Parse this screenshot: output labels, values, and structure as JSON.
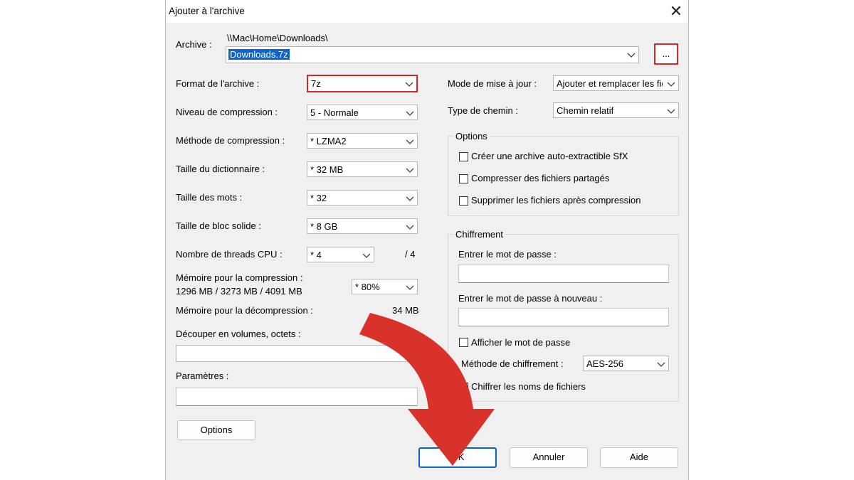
{
  "window": {
    "title": "Ajouter à l'archive",
    "close": "✕"
  },
  "archive": {
    "label": "Archive :",
    "path": "\\\\Mac\\Home\\Downloads\\",
    "filename": "Downloads.7z",
    "browse": "..."
  },
  "left": {
    "format": {
      "label": "Format de l'archive :",
      "value": "7z"
    },
    "level": {
      "label": "Niveau de compression :",
      "value": "5 - Normale"
    },
    "method": {
      "label": "Méthode de compression :",
      "value": "* LZMA2"
    },
    "dict": {
      "label": "Taille du dictionnaire :",
      "value": "* 32 MB"
    },
    "word": {
      "label": "Taille des mots :",
      "value": "* 32"
    },
    "solid": {
      "label": "Taille de bloc solide :",
      "value": "* 8 GB"
    },
    "threads": {
      "label": "Nombre de threads CPU :",
      "value": "* 4",
      "total": "/ 4"
    },
    "memcomp": {
      "label": "Mémoire pour la compression :",
      "detail": "1296 MB / 3273 MB / 4091 MB",
      "value": "* 80%"
    },
    "memdecomp": {
      "label": "Mémoire pour la décompression :",
      "value": "34 MB"
    },
    "split": {
      "label": "Découper en volumes, octets :",
      "value": ""
    },
    "params": {
      "label": "Paramètres :",
      "value": ""
    },
    "options_button": "Options"
  },
  "right": {
    "update": {
      "label": "Mode de mise à jour :",
      "value": "Ajouter et remplacer les fichiers"
    },
    "pathtype": {
      "label": "Type de chemin :",
      "value": "Chemin relatif"
    },
    "options": {
      "title": "Options",
      "items": [
        {
          "label": "Créer une archive auto-extractible SfX",
          "checked": false
        },
        {
          "label": "Compresser des fichiers partagés",
          "checked": false
        },
        {
          "label": "Supprimer les fichiers après compression",
          "checked": false
        }
      ]
    },
    "encryption": {
      "title": "Chiffrement",
      "pw_label": "Entrer le mot de passe :",
      "pw2_label": "Entrer le mot de passe à nouveau :",
      "show_pw": "Afficher le mot de passe",
      "method_label": "Méthode de chiffrement :",
      "method_value": "AES-256",
      "encrypt_names": "Chiffrer les noms de fichiers"
    }
  },
  "buttons": {
    "ok": "OK",
    "cancel": "Annuler",
    "help": "Aide"
  },
  "colors": {
    "highlight": "#d8262b",
    "arrow": "#d8322b",
    "accent": "#0a64c8"
  }
}
